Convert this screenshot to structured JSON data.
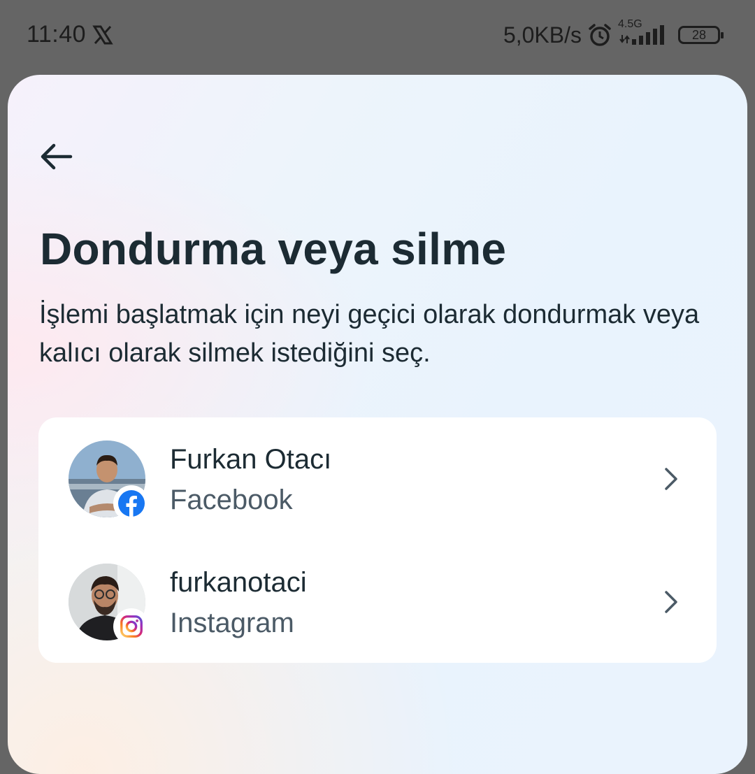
{
  "status_bar": {
    "time": "11:40",
    "net_speed": "5,0KB/s",
    "network_type": "4.5G",
    "battery": "28"
  },
  "page": {
    "title": "Dondurma veya silme",
    "description": "İşlemi başlatmak için neyi geçici olarak dondurmak veya kalıcı olarak silmek istediğini seç."
  },
  "accounts": [
    {
      "name": "Furkan Otacı",
      "platform": "Facebook",
      "badge_icon": "facebook-icon"
    },
    {
      "name": "furkanotaci",
      "platform": "Instagram",
      "badge_icon": "instagram-icon"
    }
  ],
  "colors": {
    "text_primary": "#1c2b33",
    "text_secondary": "#4b5a66",
    "facebook_blue": "#1877f2",
    "status_bar_bg": "#656565"
  }
}
